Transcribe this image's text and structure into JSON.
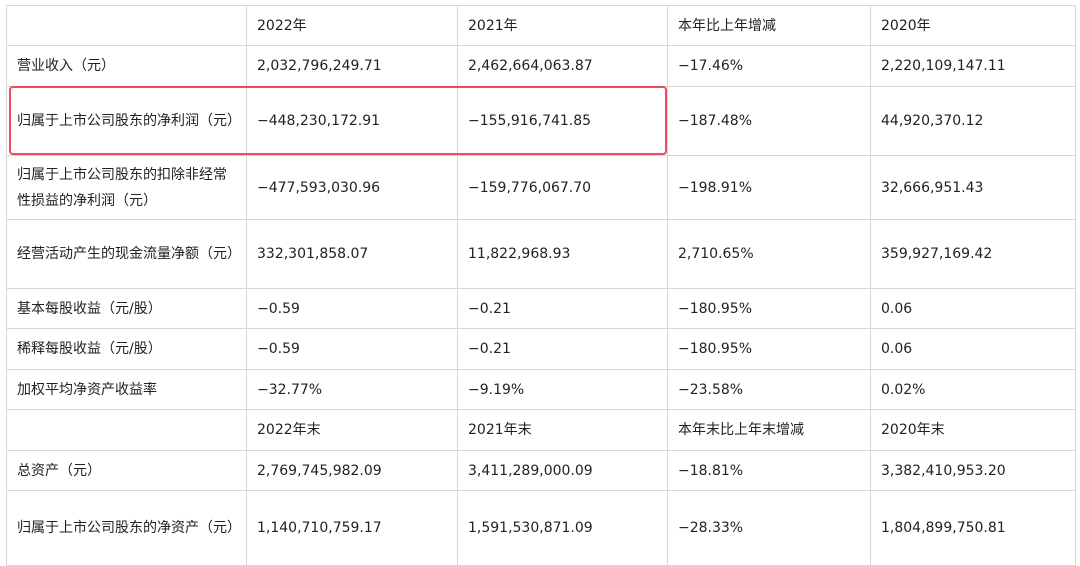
{
  "table": {
    "header1": [
      "",
      "2022年",
      "2021年",
      "本年比上年增减",
      "2020年"
    ],
    "rows1": [
      {
        "label": "营业收入（元）",
        "values": [
          "2,032,796,249.71",
          "2,462,664,063.87",
          "−17.46%",
          "2,220,109,147.11"
        ]
      },
      {
        "label": "归属于上市公司股东的净利润（元）",
        "values": [
          "−448,230,172.91",
          "−155,916,741.85",
          "−187.48%",
          "44,920,370.12"
        ]
      },
      {
        "label": "归属于上市公司股东的扣除非经常性损益的净利润（元）",
        "values": [
          "−477,593,030.96",
          "−159,776,067.70",
          "−198.91%",
          "32,666,951.43"
        ]
      },
      {
        "label": "经营活动产生的现金流量净额（元）",
        "values": [
          "332,301,858.07",
          "11,822,968.93",
          "2,710.65%",
          "359,927,169.42"
        ]
      },
      {
        "label": "基本每股收益（元/股）",
        "values": [
          "−0.59",
          "−0.21",
          "−180.95%",
          "0.06"
        ]
      },
      {
        "label": "稀释每股收益（元/股）",
        "values": [
          "−0.59",
          "−0.21",
          "−180.95%",
          "0.06"
        ]
      },
      {
        "label": "加权平均净资产收益率",
        "values": [
          "−32.77%",
          "−9.19%",
          "−23.58%",
          "0.02%"
        ]
      }
    ],
    "header2": [
      "",
      "2022年末",
      "2021年末",
      "本年末比上年末增减",
      "2020年末"
    ],
    "rows2": [
      {
        "label": "总资产（元）",
        "values": [
          "2,769,745,982.09",
          "3,411,289,000.09",
          "−18.81%",
          "3,382,410,953.20"
        ]
      },
      {
        "label": "归属于上市公司股东的净资产（元）",
        "values": [
          "1,140,710,759.17",
          "1,591,530,871.09",
          "−28.33%",
          "1,804,899,750.81"
        ]
      }
    ]
  },
  "highlight": {
    "color": "#f04a5e"
  }
}
